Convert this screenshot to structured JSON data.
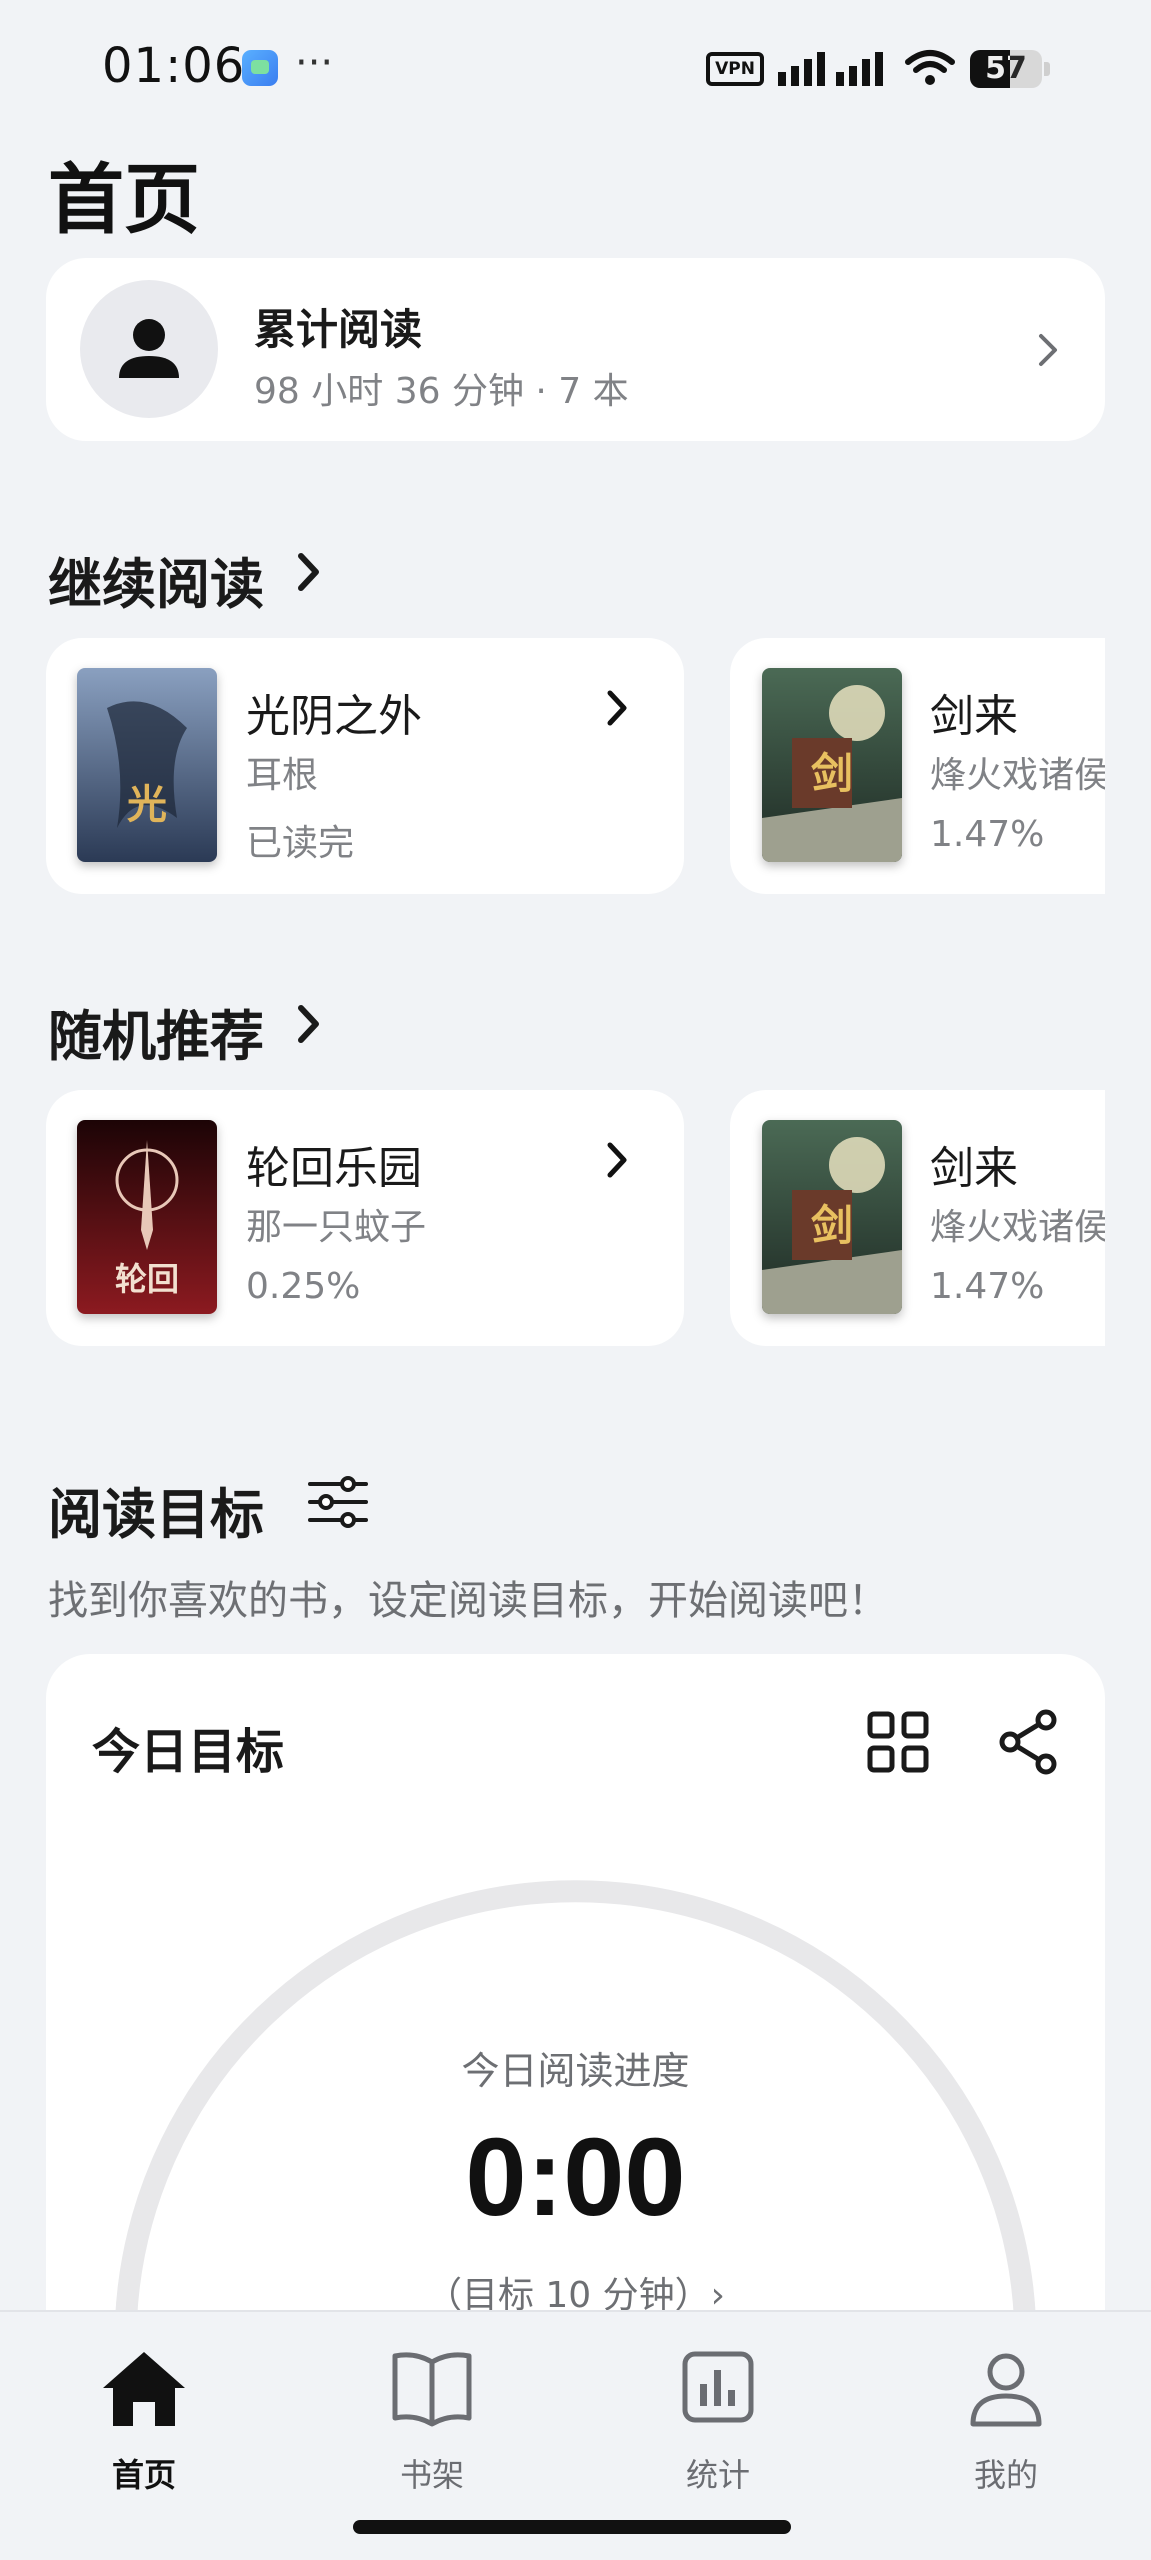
{
  "status_bar": {
    "time": "01:06",
    "more_dots": "···",
    "vpn_label": "VPN",
    "battery": "57"
  },
  "page_title": "首页",
  "summary": {
    "title": "累计阅读",
    "stats": "98 小时 36 分钟 · 7 本"
  },
  "continue_reading": {
    "title": "继续阅读",
    "books": [
      {
        "title": "光阴之外",
        "author": "耳根",
        "progress": "已读完",
        "cover_colors": [
          "#2b3a55",
          "#8aa0c0"
        ]
      },
      {
        "title": "剑来",
        "author": "烽火戏诸侯",
        "progress": "1.47%",
        "cover_colors": [
          "#2f4a3a",
          "#b8b8a0"
        ]
      }
    ]
  },
  "random_recommend": {
    "title": "随机推荐",
    "books": [
      {
        "title": "轮回乐园",
        "author": "那一只蚊子",
        "progress": "0.25%",
        "cover_colors": [
          "#3a0a0e",
          "#8c1a20"
        ]
      },
      {
        "title": "剑来",
        "author": "烽火戏诸侯",
        "progress": "1.47%",
        "cover_colors": [
          "#2f4a3a",
          "#b8b8a0"
        ]
      }
    ]
  },
  "reading_goal": {
    "title": "阅读目标",
    "subtitle": "找到你喜欢的书，设定阅读目标，开始阅读吧！",
    "card_title": "今日目标",
    "progress_label": "今日阅读进度",
    "progress_value": "0:00",
    "target_label": "（目标 10 分钟）›",
    "progress_fraction": 0
  },
  "bottom_nav": {
    "items": [
      {
        "label": "首页",
        "icon": "home-icon",
        "active": true
      },
      {
        "label": "书架",
        "icon": "book-icon",
        "active": false
      },
      {
        "label": "统计",
        "icon": "stats-icon",
        "active": false
      },
      {
        "label": "我的",
        "icon": "profile-icon",
        "active": false
      }
    ]
  },
  "colors": {
    "background": "#f1f3f6",
    "card": "#ffffff",
    "primary_text": "#1a1a1a",
    "secondary_text": "#808286",
    "gauge_track": "#e8e8ea"
  }
}
